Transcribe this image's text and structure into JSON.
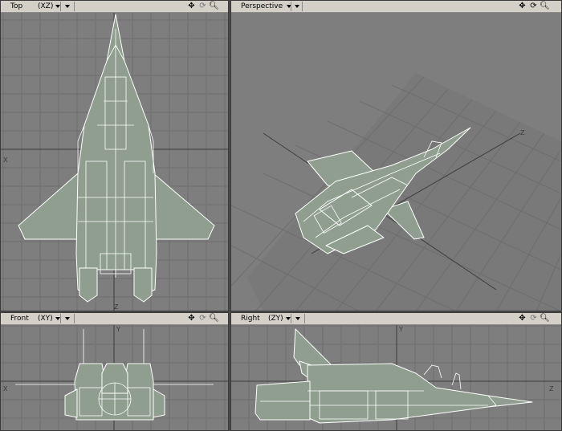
{
  "viewports": {
    "top": {
      "name": "Top",
      "axes": "(XZ)",
      "labels": {
        "x": "X",
        "z": "Z"
      }
    },
    "perspective": {
      "name": "Perspective",
      "labels": {
        "z": "Z"
      }
    },
    "front": {
      "name": "Front",
      "axes": "(XY)",
      "labels": {
        "x": "X",
        "y": "Y"
      }
    },
    "right": {
      "name": "Right",
      "axes": "(ZY)",
      "labels": {
        "z": "Z",
        "y": "Y"
      }
    }
  },
  "icons": [
    "move-icon",
    "rotate-icon",
    "zoom-icon"
  ],
  "colors": {
    "background": "#7e7e7e",
    "grid": "#6f6f6f",
    "mesh_fill": "#8f9e8e",
    "mesh_wire": "#ffffff",
    "header": "#d4d0c8"
  }
}
